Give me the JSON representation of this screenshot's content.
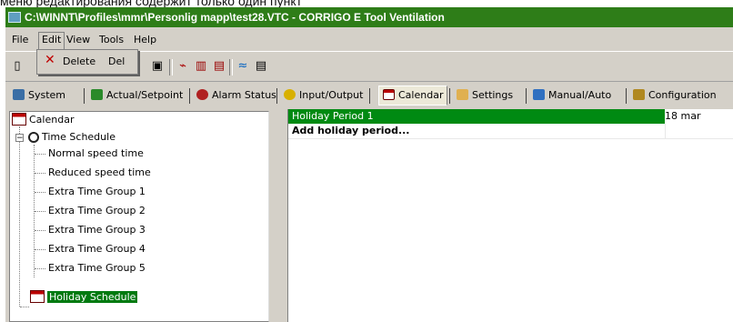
{
  "caption": "меню редактирования содержит только один пункт",
  "window": {
    "title": "C:\\WINNT\\Profiles\\mmr\\Personlig mapp\\test28.VTC - CORRIGO E Tool Ventilation"
  },
  "menubar": [
    {
      "label": "File"
    },
    {
      "label": "Edit"
    },
    {
      "label": "View"
    },
    {
      "label": "Tools"
    },
    {
      "label": "Help"
    }
  ],
  "edit_menu": {
    "item_label": "Delete",
    "shortcut": "Del"
  },
  "tabs": [
    {
      "label": "System"
    },
    {
      "label": "Actual/Setpoint"
    },
    {
      "label": "Alarm Status"
    },
    {
      "label": "Input/Output"
    },
    {
      "label": "Calendar"
    },
    {
      "label": "Settings"
    },
    {
      "label": "Manual/Auto"
    },
    {
      "label": "Configuration"
    }
  ],
  "tree": {
    "root": "Calendar",
    "time_schedule": "Time Schedule",
    "children": [
      "Normal speed time",
      "Reduced speed time",
      "Extra Time Group 1",
      "Extra Time Group 2",
      "Extra Time Group 3",
      "Extra Time Group 4",
      "Extra Time Group 5"
    ],
    "holiday": "Holiday Schedule"
  },
  "grid": {
    "rows": [
      {
        "name": "Holiday Period 1",
        "value": "18 mar"
      },
      {
        "name": "Add holiday period...",
        "value": ""
      }
    ]
  },
  "colors": {
    "title_bar": "#2e7d18",
    "selection": "#007a10",
    "frame": "#d4d0c8"
  }
}
